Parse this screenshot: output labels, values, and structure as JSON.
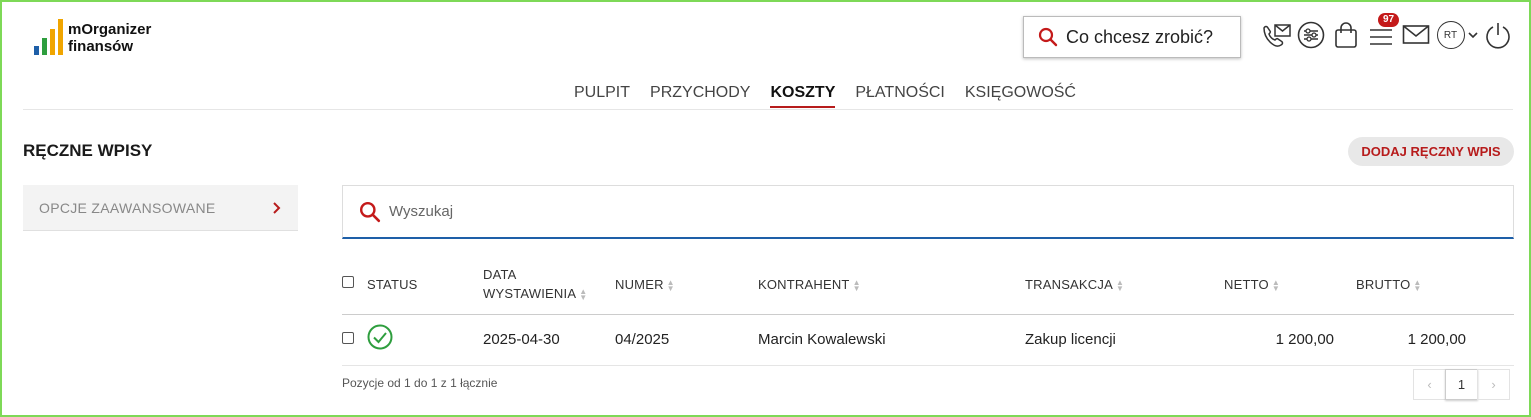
{
  "app": {
    "logo_line1": "mOrganizer",
    "logo_line2": "finansów",
    "logo_colors": [
      "#1e5fa8",
      "#2e9e3e",
      "#f0a500",
      "#f0a500"
    ]
  },
  "header": {
    "quick_action_label": "Co chcesz zrobić?",
    "icons": [
      "phone-mail-icon",
      "settings-sliders-icon",
      "shopping-bag-icon",
      "task-list-icon",
      "mail-icon",
      "avatar",
      "power-icon"
    ],
    "notifications_count": "97",
    "user_initials": "RT"
  },
  "nav": {
    "tabs": [
      {
        "label": "PULPIT",
        "active": false
      },
      {
        "label": "PRZYCHODY",
        "active": false
      },
      {
        "label": "KOSZTY",
        "active": true
      },
      {
        "label": "PŁATNOŚCI",
        "active": false
      },
      {
        "label": "KSIĘGOWOŚĆ",
        "active": false
      }
    ]
  },
  "page": {
    "title": "RĘCZNE WPISY",
    "add_button": "DODAJ RĘCZNY WPIS",
    "advanced_options": "OPCJE ZAAWANSOWANE",
    "search_placeholder": "Wyszukaj"
  },
  "table": {
    "columns": {
      "status": "STATUS",
      "date_line1": "DATA",
      "date_line2": "WYSTAWIENIA",
      "number": "NUMER",
      "contractor": "KONTRAHENT",
      "transaction": "TRANSAKCJA",
      "net": "NETTO",
      "gross": "BRUTTO"
    },
    "rows": [
      {
        "status": "ok",
        "date": "2025-04-30",
        "number": "04/2025",
        "contractor": "Marcin Kowalewski",
        "transaction": "Zakup licencji",
        "net": "1 200,00",
        "gross": "1 200,00"
      }
    ]
  },
  "footer": {
    "summary": "Pozycje od 1 do 1 z 1 łącznie",
    "current_page": "1",
    "prev": "‹",
    "next": "›"
  },
  "colors": {
    "accent": "#b71c1c",
    "search_underline": "#1e5fa8",
    "status_ok": "#2e9e3e",
    "frame": "#7ed957"
  }
}
